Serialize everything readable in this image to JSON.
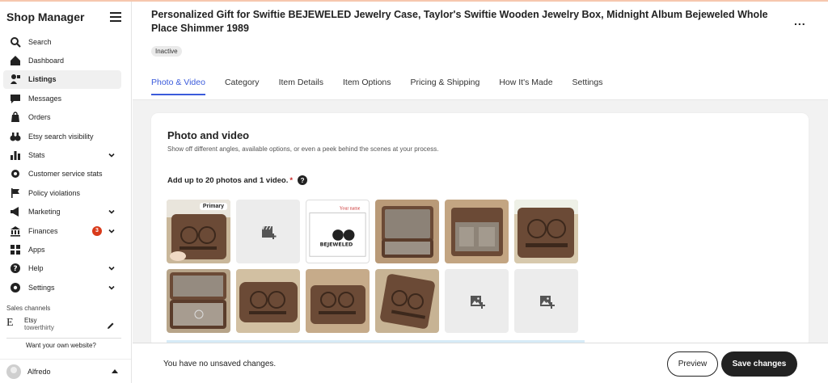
{
  "sidebar": {
    "title": "Shop Manager",
    "items": [
      {
        "label": "Search",
        "icon": "search-icon"
      },
      {
        "label": "Dashboard",
        "icon": "home-icon"
      },
      {
        "label": "Listings",
        "icon": "listings-icon",
        "active": true
      },
      {
        "label": "Messages",
        "icon": "messages-icon"
      },
      {
        "label": "Orders",
        "icon": "orders-icon"
      },
      {
        "label": "Etsy search visibility",
        "icon": "binoculars-icon"
      },
      {
        "label": "Stats",
        "icon": "stats-icon",
        "expandable": true
      },
      {
        "label": "Customer service stats",
        "icon": "gear-icon"
      },
      {
        "label": "Policy violations",
        "icon": "flag-icon"
      },
      {
        "label": "Marketing",
        "icon": "megaphone-icon",
        "expandable": true
      },
      {
        "label": "Finances",
        "icon": "bank-icon",
        "badge": "3",
        "expandable": true
      },
      {
        "label": "Apps",
        "icon": "apps-icon"
      },
      {
        "label": "Help",
        "icon": "help-icon",
        "expandable": true
      },
      {
        "label": "Settings",
        "icon": "settings-icon",
        "expandable": true
      }
    ],
    "sales_channels_label": "Sales channels",
    "channel": {
      "letter": "E",
      "name": "Etsy",
      "shop": "towerthirty"
    },
    "website_prompt": "Want your own website?",
    "user": {
      "name": "Alfredo"
    }
  },
  "header": {
    "title": "Personalized Gift for Swiftie BEJEWELED Jewelry Case, Taylor's Swiftie Wooden Jewelry Box, Midnight Album Bejeweled Whole Place Shimmer 1989",
    "more": "...",
    "status": "Inactive"
  },
  "tabs": [
    {
      "label": "Photo & Video",
      "active": true
    },
    {
      "label": "Category"
    },
    {
      "label": "Item Details"
    },
    {
      "label": "Item Options"
    },
    {
      "label": "Pricing & Shipping"
    },
    {
      "label": "How It's Made"
    },
    {
      "label": "Settings"
    }
  ],
  "photo_section": {
    "title": "Photo and video",
    "description": "Show off different angles, available options, or even a peek behind the scenes at your process.",
    "add_label": "Add up to 20 photos and 1 video.",
    "required_mark": "*",
    "help": "?",
    "primary_label": "Primary",
    "certificate_text": "Your name",
    "certificate_word": "BEJEWELED"
  },
  "footer": {
    "message": "You have no unsaved changes.",
    "preview_label": "Preview",
    "save_label": "Save changes"
  },
  "colors": {
    "accent": "#3b5bdb",
    "badge": "#d93a1a",
    "wood": "#6b4a36"
  }
}
